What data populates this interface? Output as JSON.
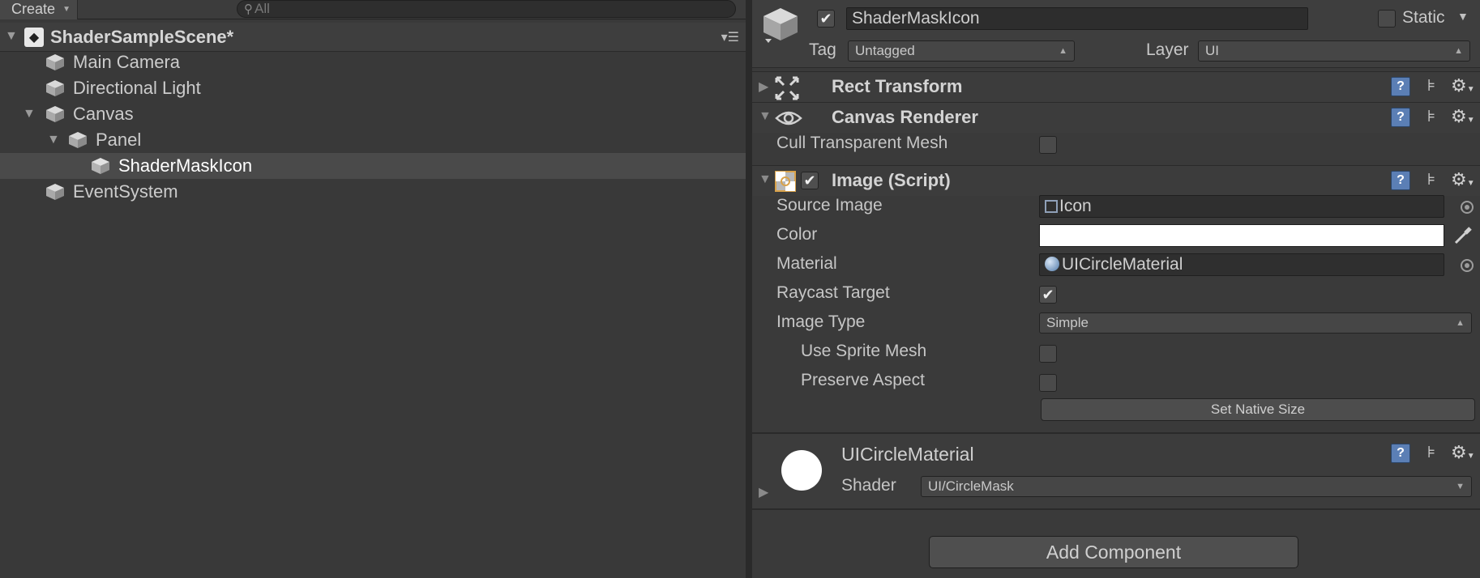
{
  "hierarchy": {
    "create_label": "Create",
    "search_placeholder": "All",
    "scene_name": "ShaderSampleScene*",
    "items": [
      {
        "label": "Main Camera"
      },
      {
        "label": "Directional Light"
      },
      {
        "label": "Canvas"
      },
      {
        "label": "Panel"
      },
      {
        "label": "ShaderMaskIcon"
      },
      {
        "label": "EventSystem"
      }
    ],
    "selected_item": "ShaderMaskIcon"
  },
  "inspector": {
    "object_name": "ShaderMaskIcon",
    "static_label": "Static",
    "tag_label": "Tag",
    "tag_value": "Untagged",
    "layer_label": "Layer",
    "layer_value": "UI",
    "rect_transform": {
      "title": "Rect Transform"
    },
    "canvas_renderer": {
      "title": "Canvas Renderer",
      "cull_label": "Cull Transparent Mesh"
    },
    "image": {
      "title": "Image (Script)",
      "source_image_label": "Source Image",
      "source_image_value": "Icon",
      "color_label": "Color",
      "color_value": "#ffffff",
      "material_label": "Material",
      "material_value": "UICircleMaterial",
      "raycast_label": "Raycast Target",
      "image_type_label": "Image Type",
      "image_type_value": "Simple",
      "use_sprite_mesh_label": "Use Sprite Mesh",
      "preserve_aspect_label": "Preserve Aspect",
      "set_native_size_label": "Set Native Size"
    },
    "material": {
      "name": "UICircleMaterial",
      "shader_label": "Shader",
      "shader_value": "UI/CircleMask"
    },
    "add_component_label": "Add Component"
  }
}
